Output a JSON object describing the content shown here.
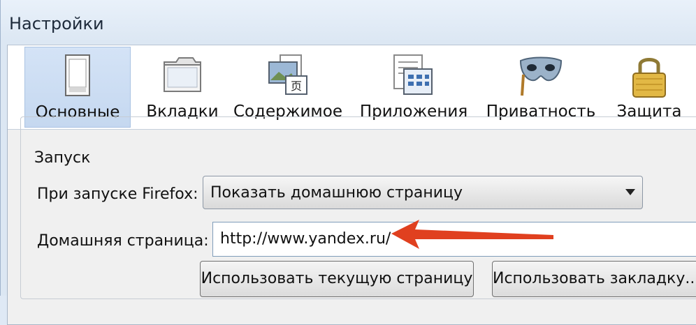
{
  "window": {
    "title": "Настройки"
  },
  "toolbar": {
    "tabs": [
      {
        "label": "Основные",
        "icon": "general-icon",
        "active": true
      },
      {
        "label": "Вкладки",
        "icon": "tabs-icon",
        "active": false
      },
      {
        "label": "Содержимое",
        "icon": "content-icon",
        "active": false
      },
      {
        "label": "Приложения",
        "icon": "applications-icon",
        "active": false
      },
      {
        "label": "Приватность",
        "icon": "privacy-mask-icon",
        "active": false
      },
      {
        "label": "Защита",
        "icon": "security-lock-icon",
        "active": false
      }
    ]
  },
  "startup": {
    "group_title": "Запуск",
    "on_start_label": "При запуске Firefox:",
    "on_start_value": "Показать домашнюю страницу",
    "home_page_label": "Домашняя страница:",
    "home_page_value": "http://www.yandex.ru/",
    "use_current_button": "Использовать текущую страницу",
    "use_bookmark_button": "Использовать закладку..."
  },
  "colors": {
    "annotation_arrow": "#e0401f",
    "active_tab": "#c9dbf1"
  }
}
